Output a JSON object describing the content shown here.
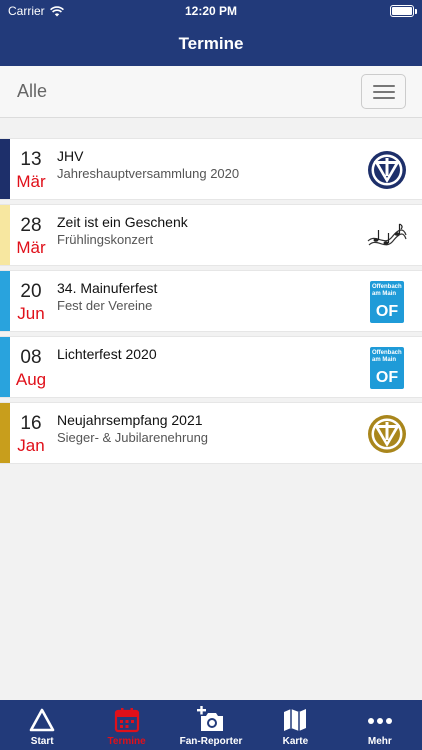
{
  "status_bar": {
    "carrier": "Carrier",
    "time": "12:20 PM"
  },
  "nav": {
    "title": "Termine"
  },
  "filter": {
    "label": "Alle",
    "menu_icon": "hamburger-icon"
  },
  "events": [
    {
      "day": "13",
      "month": "Mär",
      "title": "JHV",
      "subtitle": "Jahreshauptversammlung 2020",
      "accent": "#1d2f6a",
      "logo": "club-emblem-blue"
    },
    {
      "day": "28",
      "month": "Mär",
      "title": "Zeit ist ein Geschenk",
      "subtitle": "Frühlingskonzert",
      "accent": "#f7e7a0",
      "logo": "music-notes"
    },
    {
      "day": "20",
      "month": "Jun",
      "title": "34. Mainuferfest",
      "subtitle": "Fest der Vereine",
      "accent": "#29a3dd",
      "logo": "offenbach-logo",
      "logo_text_small": "Offenbach am Main",
      "logo_text_big": "OF"
    },
    {
      "day": "08",
      "month": "Aug",
      "title": "Lichterfest 2020",
      "subtitle": "",
      "accent": "#29a3dd",
      "logo": "offenbach-logo",
      "logo_text_small": "Offenbach am Main",
      "logo_text_big": "OF"
    },
    {
      "day": "16",
      "month": "Jan",
      "title": "Neujahrsempfang 2021",
      "subtitle": "Sieger- & Jubilarenehrung",
      "accent": "#c89e1c",
      "logo": "club-emblem-gold"
    }
  ],
  "tabs": [
    {
      "label": "Start",
      "icon": "triangle-icon",
      "active": false
    },
    {
      "label": "Termine",
      "icon": "calendar-icon",
      "active": true
    },
    {
      "label": "Fan-Reporter",
      "icon": "camera-add-icon",
      "active": false
    },
    {
      "label": "Karte",
      "icon": "map-icon",
      "active": false
    },
    {
      "label": "Mehr",
      "icon": "more-icon",
      "active": false
    }
  ],
  "colors": {
    "brand": "#223a7a",
    "accent_red": "#e0101a"
  }
}
